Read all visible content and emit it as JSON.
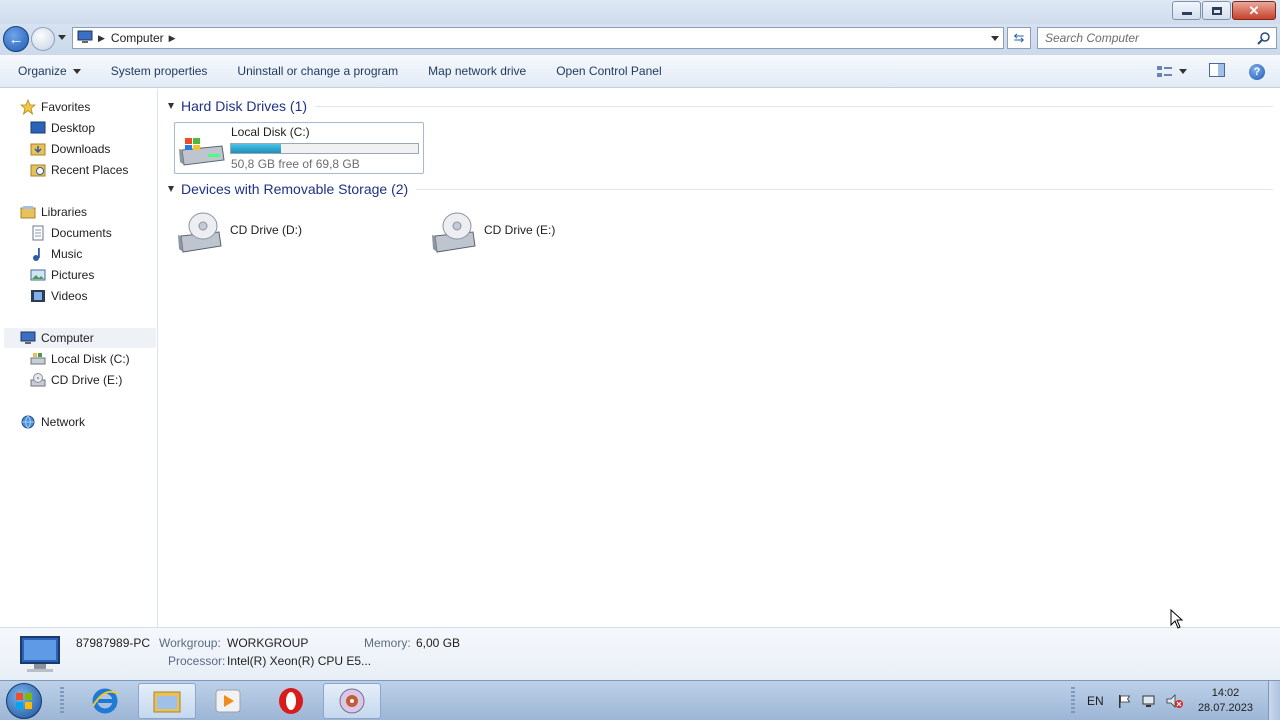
{
  "window": {
    "title": "Computer"
  },
  "address": {
    "crumbs": [
      "Computer"
    ],
    "search_placeholder": "Search Computer"
  },
  "toolbar": {
    "organize": "Organize",
    "system_properties": "System properties",
    "uninstall": "Uninstall or change a program",
    "map_drive": "Map network drive",
    "control_panel": "Open Control Panel"
  },
  "nav": {
    "favorites": "Favorites",
    "favorites_items": [
      "Desktop",
      "Downloads",
      "Recent Places"
    ],
    "libraries": "Libraries",
    "libraries_items": [
      "Documents",
      "Music",
      "Pictures",
      "Videos"
    ],
    "computer": "Computer",
    "computer_items": [
      "Local Disk (C:)",
      "CD Drive (E:)"
    ],
    "network": "Network"
  },
  "groups": {
    "hdd_title": "Hard Disk Drives (1)",
    "removable_title": "Devices with Removable Storage (2)"
  },
  "drives": {
    "c": {
      "name": "Local Disk (C:)",
      "free_text": "50,8 GB free of 69,8 GB",
      "used_fraction": 0.27
    },
    "d": {
      "name": "CD Drive (D:)"
    },
    "e": {
      "name": "CD Drive (E:)"
    }
  },
  "details": {
    "pc_name": "87987989-PC",
    "workgroup_label": "Workgroup:",
    "workgroup": "WORKGROUP",
    "memory_label": "Memory:",
    "memory": "6,00 GB",
    "processor_label": "Processor:",
    "processor": "Intel(R) Xeon(R) CPU E5..."
  },
  "taskbar": {
    "language": "EN",
    "time": "14:02",
    "date": "28.07.2023",
    "apps": [
      "internet-explorer-icon",
      "windows-explorer-icon",
      "media-player-icon",
      "opera-icon",
      "cd-burner-icon"
    ]
  },
  "colors": {
    "accent": "#1e3287",
    "usage_bar": "#26a6d1",
    "taskbar": "#a9c0dd"
  }
}
